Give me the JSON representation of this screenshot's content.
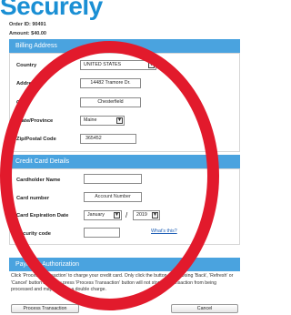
{
  "page": {
    "title": "Securely"
  },
  "order": {
    "order_id_text": "Order ID: 90491",
    "amount_text": "Amount: $40.00"
  },
  "billing": {
    "header": "Billing Address",
    "country_label": "Country",
    "country_value": "UNITED STATES",
    "address_label": "Address",
    "address_value": "14482 Tramore Dr.",
    "city_label": "City",
    "city_value": "Chesterfield",
    "state_label": "State/Province",
    "state_value": "Maine",
    "zip_label": "Zip/Postal Code",
    "zip_value": "365452"
  },
  "card": {
    "header": "Credit Card Details",
    "holder_label": "Cardholder Name",
    "holder_value": "",
    "number_label": "Card number",
    "number_value": "Account Number",
    "expiration_label": "Card Expiration Date",
    "exp_month": "January",
    "exp_separator": "/",
    "exp_year": "2019",
    "security_label": "Security code",
    "security_value": "",
    "whats_this": "What's this?"
  },
  "payment": {
    "header": "Payment Authorization",
    "instructions": "Click 'Process Transaction' to charge your credit card. Only click the button once. Using 'Back', 'Refresh' or 'Cancel' button after you press 'Process Transaction' button will not stop the transaction from being processed and may result in a double charge.",
    "process_button": "Process Transaction",
    "cancel_button": "Cancel"
  },
  "overlay": {
    "ring_color": "#e21a2c",
    "accent_color": "#4aa3df"
  }
}
